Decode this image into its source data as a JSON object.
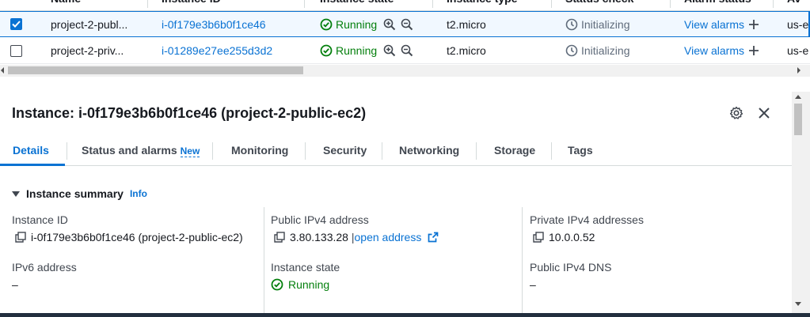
{
  "table": {
    "columns": [
      "Name",
      "Instance ID",
      "Instance state",
      "Instance type",
      "Status check",
      "Alarm status",
      "Av"
    ],
    "rows": [
      {
        "selected": true,
        "name": "project-2-publ...",
        "instance_id": "i-0f179e3b6b0f1ce46",
        "state": "Running",
        "type": "t2.micro",
        "status_check": "Initializing",
        "alarm": "View alarms",
        "az": "us-e"
      },
      {
        "selected": false,
        "name": "project-2-priv...",
        "instance_id": "i-01289e27ee255d3d2",
        "state": "Running",
        "type": "t2.micro",
        "status_check": "Initializing",
        "alarm": "View alarms",
        "az": "us-e"
      }
    ]
  },
  "panel": {
    "title": "Instance: i-0f179e3b6b0f1ce46 (project-2-public-ec2)",
    "tabs": [
      {
        "label": "Details",
        "active": true
      },
      {
        "label": "Status and alarms",
        "badge": "New"
      },
      {
        "label": "Monitoring"
      },
      {
        "label": "Security"
      },
      {
        "label": "Networking"
      },
      {
        "label": "Storage"
      },
      {
        "label": "Tags"
      }
    ],
    "section": {
      "title": "Instance summary",
      "info": "Info"
    },
    "fields": {
      "instance_id": {
        "label": "Instance ID",
        "value": "i-0f179e3b6b0f1ce46 (project-2-public-ec2)"
      },
      "public_ipv4": {
        "label": "Public IPv4 address",
        "value": "3.80.133.28",
        "link": "open address"
      },
      "private_ipv4": {
        "label": "Private IPv4 addresses",
        "value": "10.0.0.52"
      },
      "ipv6": {
        "label": "IPv6 address",
        "value": "–"
      },
      "instance_state": {
        "label": "Instance state",
        "value": "Running"
      },
      "public_dns": {
        "label": "Public IPv4 DNS",
        "value": "–"
      }
    }
  },
  "colors": {
    "accent": "#0972d3",
    "success": "#037f0c",
    "muted": "#5f6b7a",
    "border": "#d5dbdb"
  }
}
